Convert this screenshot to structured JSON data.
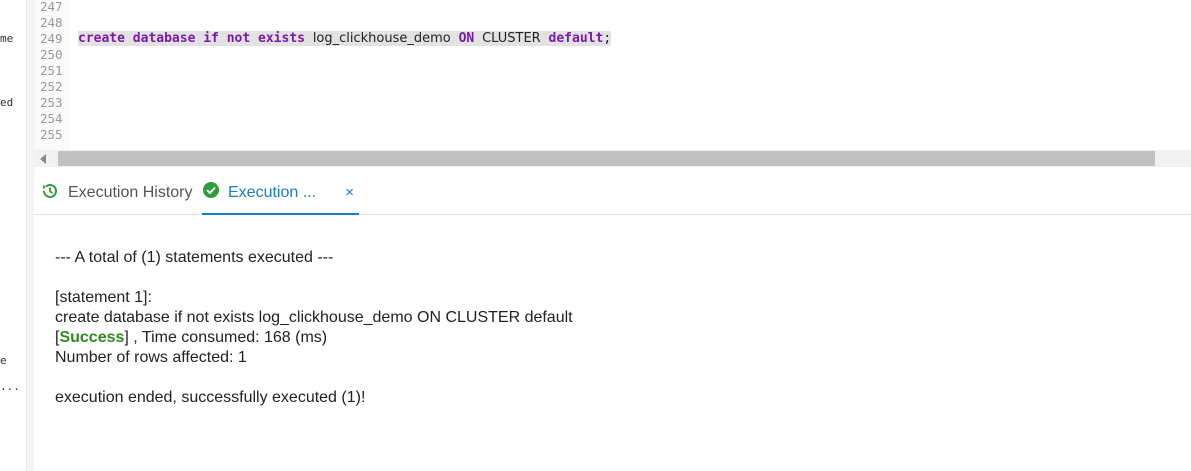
{
  "left_fragments": [
    "me",
    "ed",
    "e",
    "..."
  ],
  "editor": {
    "line_numbers": [
      "247",
      "248",
      "249",
      "250",
      "251",
      "252",
      "253",
      "254",
      "255"
    ],
    "statement": {
      "kw1": "create database if not exists",
      "name": "log_clickhouse_demo",
      "kw2": "ON",
      "cluster": "CLUSTER",
      "kw3": "default",
      "terminator": ";"
    }
  },
  "tabs": {
    "history_label": "Execution History",
    "active_label": "Execution ...",
    "close": "×"
  },
  "output": {
    "summary": "--- A total of (1) statements executed ---",
    "statement_header": "[statement 1]:",
    "statement_text": "create database if not exists log_clickhouse_demo ON CLUSTER default",
    "result_open": "[",
    "result_status": "Success",
    "result_rest": "] , Time consumed: 168 (ms)",
    "rows": "Number of rows affected: 1",
    "ended": "execution ended, successfully executed (1)!"
  },
  "colors": {
    "keyword": "#7a1aa8",
    "accent": "#1a7cc8",
    "success": "#2f8a1f"
  }
}
